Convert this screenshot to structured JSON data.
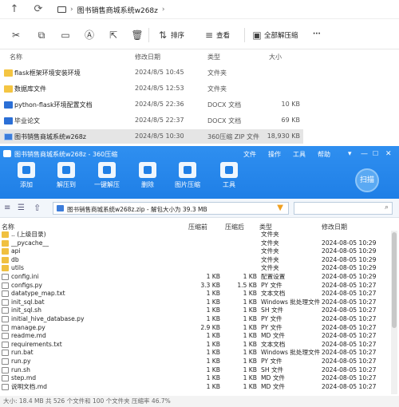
{
  "explorer": {
    "address": [
      "图书销售商城系统w268z"
    ],
    "toolbar": {
      "sort": "排序",
      "view": "查看",
      "extract_all": "全部解压缩",
      "more": "···"
    },
    "columns": {
      "name": "名称",
      "modified": "修改日期",
      "type": "类型",
      "size": "大小"
    },
    "files": [
      {
        "name": "flask框架环境安装环境",
        "date": "2024/8/5 10:45",
        "type": "文件夹",
        "size": "",
        "icon": "folder-icon"
      },
      {
        "name": "数据库文件",
        "date": "2024/8/5 12:53",
        "type": "文件夹",
        "size": "",
        "icon": "folder-icon"
      },
      {
        "name": "python-flask环境配置文档",
        "date": "2024/8/5 22:36",
        "type": "DOCX 文档",
        "size": "10 KB",
        "icon": "docx-icon"
      },
      {
        "name": "毕业论文",
        "date": "2024/8/5 22:37",
        "type": "DOCX 文档",
        "size": "69 KB",
        "icon": "docx-icon"
      },
      {
        "name": "图书销售商城系统w268z",
        "date": "2024/8/5 10:30",
        "type": "360压缩 ZIP 文件",
        "size": "18,930 KB",
        "icon": "zip-icon"
      }
    ]
  },
  "zip": {
    "title": "图书销售商城系统w268z - 360压缩",
    "menu": [
      "文件",
      "操作",
      "工具",
      "帮助"
    ],
    "tools": [
      "添加",
      "解压到",
      "一键解压",
      "删除",
      "图片压缩",
      "工具"
    ],
    "scan": "扫描",
    "path": "图书销售商城系统w268z.zip - 解包大小为 39.3 MB",
    "columns": {
      "name": "名称",
      "packed": "压缩前",
      "compressed": "压缩后",
      "type": "类型",
      "date": "修改日期"
    },
    "rows": [
      {
        "name": ".. (上级目录)",
        "a": "",
        "b": "",
        "type": "文件夹",
        "date": "",
        "k": "folder"
      },
      {
        "name": "__pycache__",
        "a": "",
        "b": "",
        "type": "文件夹",
        "date": "2024-08-05 10:29",
        "k": "folder"
      },
      {
        "name": "api",
        "a": "",
        "b": "",
        "type": "文件夹",
        "date": "2024-08-05 10:29",
        "k": "folder"
      },
      {
        "name": "db",
        "a": "",
        "b": "",
        "type": "文件夹",
        "date": "2024-08-05 10:29",
        "k": "folder"
      },
      {
        "name": "utils",
        "a": "",
        "b": "",
        "type": "文件夹",
        "date": "2024-08-05 10:29",
        "k": "folder"
      },
      {
        "name": "config.ini",
        "a": "1 KB",
        "b": "1 KB",
        "type": "配置设置",
        "date": "2024-08-05 10:29",
        "k": "file"
      },
      {
        "name": "configs.py",
        "a": "3.3 KB",
        "b": "1.5 KB",
        "type": "PY 文件",
        "date": "2024-08-05 10:27",
        "k": "file"
      },
      {
        "name": "datatype_map.txt",
        "a": "1 KB",
        "b": "1 KB",
        "type": "文本文档",
        "date": "2024-08-05 10:27",
        "k": "file"
      },
      {
        "name": "init_sql.bat",
        "a": "1 KB",
        "b": "1 KB",
        "type": "Windows 批处理文件",
        "date": "2024-08-05 10:27",
        "k": "file"
      },
      {
        "name": "init_sql.sh",
        "a": "1 KB",
        "b": "1 KB",
        "type": "SH 文件",
        "date": "2024-08-05 10:27",
        "k": "file"
      },
      {
        "name": "initial_hive_database.py",
        "a": "1 KB",
        "b": "1 KB",
        "type": "PY 文件",
        "date": "2024-08-05 10:27",
        "k": "file"
      },
      {
        "name": "manage.py",
        "a": "2.9 KB",
        "b": "1 KB",
        "type": "PY 文件",
        "date": "2024-08-05 10:27",
        "k": "file"
      },
      {
        "name": "readme.md",
        "a": "1 KB",
        "b": "1 KB",
        "type": "MD 文件",
        "date": "2024-08-05 10:27",
        "k": "file"
      },
      {
        "name": "requirements.txt",
        "a": "1 KB",
        "b": "1 KB",
        "type": "文本文档",
        "date": "2024-08-05 10:27",
        "k": "file"
      },
      {
        "name": "run.bat",
        "a": "1 KB",
        "b": "1 KB",
        "type": "Windows 批处理文件",
        "date": "2024-08-05 10:27",
        "k": "file"
      },
      {
        "name": "run.py",
        "a": "1 KB",
        "b": "1 KB",
        "type": "PY 文件",
        "date": "2024-08-05 10:27",
        "k": "file"
      },
      {
        "name": "run.sh",
        "a": "1 KB",
        "b": "1 KB",
        "type": "SH 文件",
        "date": "2024-08-05 10:27",
        "k": "file"
      },
      {
        "name": "step.md",
        "a": "1 KB",
        "b": "1 KB",
        "type": "MD 文件",
        "date": "2024-08-05 10:27",
        "k": "file"
      },
      {
        "name": "说明文档.md",
        "a": "1 KB",
        "b": "1 KB",
        "type": "MD 文件",
        "date": "2024-08-05 10:27",
        "k": "file"
      }
    ],
    "status": "大小: 18.4 MB 共 526 个文件和 100 个文件夹 压缩率 46.7%"
  },
  "colors": {
    "accent": "#1f7fe6",
    "folder": "#f4c542"
  }
}
